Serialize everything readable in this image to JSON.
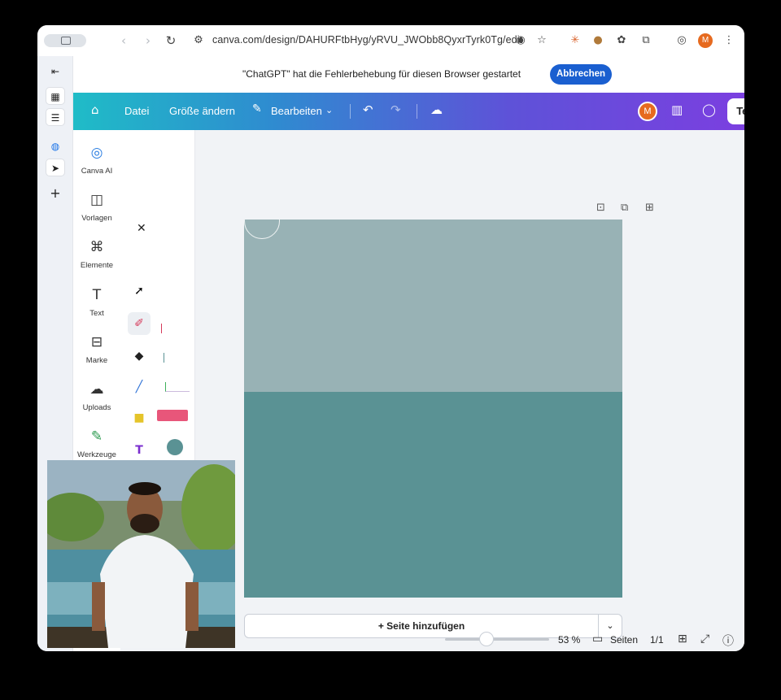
{
  "browser": {
    "url": "canva.com/design/DAHURFtbHyg/yRVU_JWObb8QyxrTyrk0Tg/edit",
    "profile_initial": "M"
  },
  "notification": {
    "text": "\"ChatGPT\" hat die Fehlerbehebung für diesen Browser gestartet",
    "cancel_label": "Abbrechen"
  },
  "header": {
    "file_label": "Datei",
    "resize_label": "Größe ändern",
    "edit_label": "Bearbeiten",
    "avatar_initial": "M",
    "share_label": "Teilen"
  },
  "sidebar": {
    "items": [
      {
        "label": "Canva AI",
        "icon": "canva-ai-icon"
      },
      {
        "label": "Vorlagen",
        "icon": "templates-icon"
      },
      {
        "label": "Elemente",
        "icon": "elements-icon"
      },
      {
        "label": "Text",
        "icon": "text-icon"
      },
      {
        "label": "Marke",
        "icon": "brand-icon"
      },
      {
        "label": "Uploads",
        "icon": "uploads-icon"
      },
      {
        "label": "Werkzeuge",
        "icon": "tools-icon"
      }
    ]
  },
  "canvas": {
    "top_color": "#98b2b5",
    "bottom_color": "#5a9294",
    "add_page_label": "+ Seite hinzufügen"
  },
  "statusbar": {
    "zoom": "53 %",
    "zoom_fraction": 0.4,
    "pages_label": "Seiten",
    "page_count": "1/1"
  },
  "colors": {
    "brand_gradient_start": "#1fbcc7",
    "brand_gradient_end": "#7b3fe0",
    "notice_button": "#1a5fd0",
    "avatar": "#e66a1f"
  }
}
